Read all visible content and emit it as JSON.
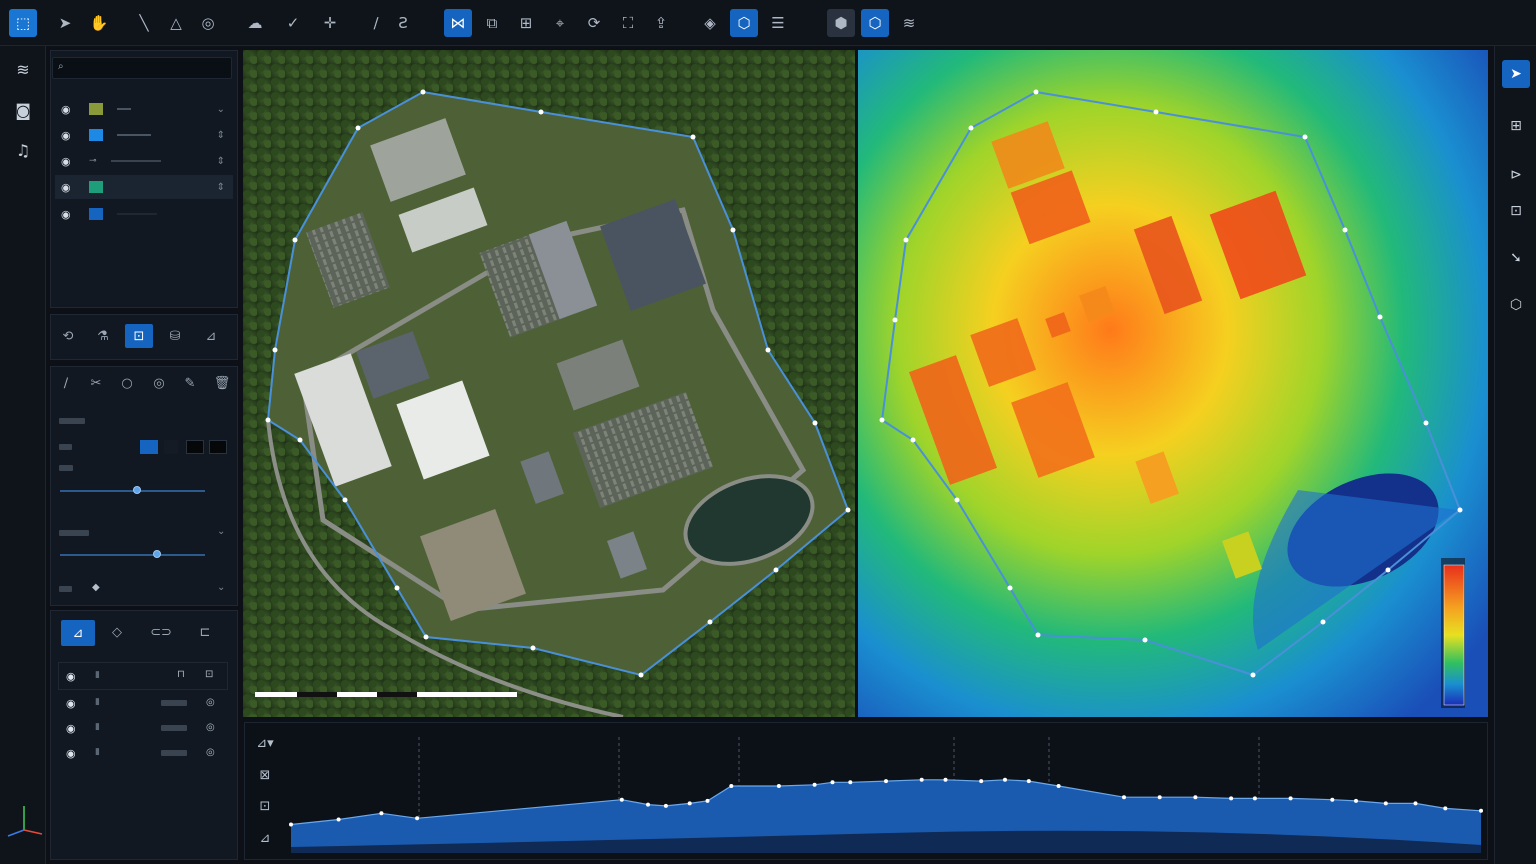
{
  "toolbar": {
    "groups": [
      [
        "logo-icon"
      ],
      [
        "select-icon",
        "pan-icon"
      ],
      [
        "line-icon",
        "polygon-icon",
        "circle-icon"
      ],
      [
        "cloud-icon",
        "check-shape-icon",
        "move-icon"
      ],
      [
        "measure-line-icon",
        "measure-area-icon"
      ],
      [
        "topology-icon",
        "compare-icon",
        "raster-icon",
        "pointer-icon",
        "sync-icon",
        "crop-icon",
        "export-icon"
      ],
      [
        "compass-icon",
        "cube-icon",
        "stack-icon"
      ],
      [
        "box3d-icon",
        "cube-active-icon",
        "layers-icon"
      ]
    ]
  },
  "layers": [
    {
      "color": "#8a9a3a",
      "visible": true
    },
    {
      "color": "#1e88e5",
      "visible": true
    },
    {
      "color": "#2f3a46",
      "visible": true
    },
    {
      "color": "#1e9e7a",
      "visible": true
    },
    {
      "color": "#1565c0",
      "visible": true
    }
  ],
  "scalebar": {
    "ticks": [
      "0",
      "",
      "",
      "",
      "",
      ""
    ]
  },
  "colors": {
    "accent": "#1565c0",
    "panel": "#111821",
    "background": "#0d1117",
    "boundary": "#4a90d9",
    "profile_fill": "#1a5bb0"
  },
  "profile": {
    "points": [
      [
        0,
        0.77
      ],
      [
        0.04,
        0.73
      ],
      [
        0.076,
        0.68
      ],
      [
        0.106,
        0.72
      ],
      [
        0.278,
        0.57
      ],
      [
        0.3,
        0.61
      ],
      [
        0.315,
        0.62
      ],
      [
        0.335,
        0.6
      ],
      [
        0.35,
        0.58
      ],
      [
        0.37,
        0.46
      ],
      [
        0.41,
        0.46
      ],
      [
        0.44,
        0.45
      ],
      [
        0.455,
        0.43
      ],
      [
        0.47,
        0.43
      ],
      [
        0.5,
        0.42
      ],
      [
        0.53,
        0.41
      ],
      [
        0.55,
        0.41
      ],
      [
        0.58,
        0.42
      ],
      [
        0.6,
        0.41
      ],
      [
        0.62,
        0.42
      ],
      [
        0.645,
        0.46
      ],
      [
        0.7,
        0.55
      ],
      [
        0.73,
        0.55
      ],
      [
        0.76,
        0.55
      ],
      [
        0.79,
        0.56
      ],
      [
        0.81,
        0.56
      ],
      [
        0.84,
        0.56
      ],
      [
        0.875,
        0.57
      ],
      [
        0.895,
        0.58
      ],
      [
        0.92,
        0.6
      ],
      [
        0.945,
        0.6
      ],
      [
        0.97,
        0.64
      ],
      [
        1.0,
        0.66
      ]
    ]
  }
}
